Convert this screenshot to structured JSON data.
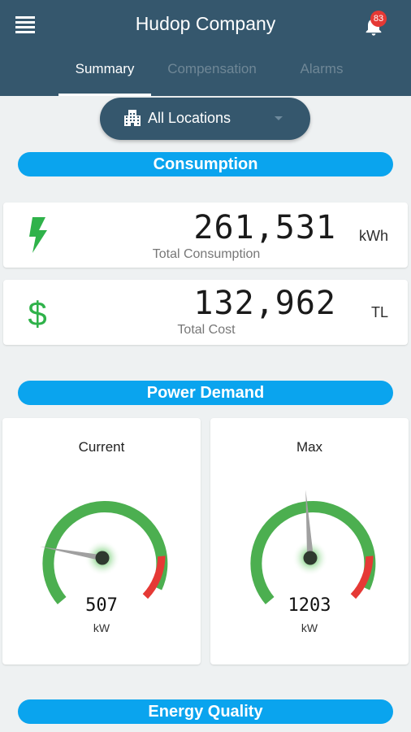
{
  "header": {
    "title": "Hudop Company",
    "notification_count": "83",
    "tabs": [
      {
        "label": "Summary",
        "active": true
      },
      {
        "label": "Compensation",
        "active": false
      },
      {
        "label": "Alarms",
        "active": false
      }
    ]
  },
  "location_select": {
    "value": "All Locations",
    "icon": "building-icon"
  },
  "sections": {
    "consumption": "Consumption",
    "power_demand": "Power Demand",
    "energy_quality": "Energy Quality"
  },
  "metrics": {
    "consumption": {
      "value": "261,531",
      "unit": "kWh",
      "label": "Total Consumption",
      "icon": "lightning-bolt-icon",
      "icon_color": "#2fb24a"
    },
    "cost": {
      "value": "132,962",
      "unit": "TL",
      "label": "Total Cost",
      "icon": "dollar-icon",
      "icon_color": "#2fb24a"
    }
  },
  "gauges": {
    "current": {
      "title": "Current",
      "value": "507",
      "unit": "kW"
    },
    "max": {
      "title": "Max",
      "value": "1203",
      "unit": "kW"
    }
  },
  "colors": {
    "header_bg": "#35576d",
    "section_bar": "#0aa4ee",
    "gauge_ok": "#4caf50",
    "gauge_danger": "#e53935",
    "badge": "#e53935"
  }
}
